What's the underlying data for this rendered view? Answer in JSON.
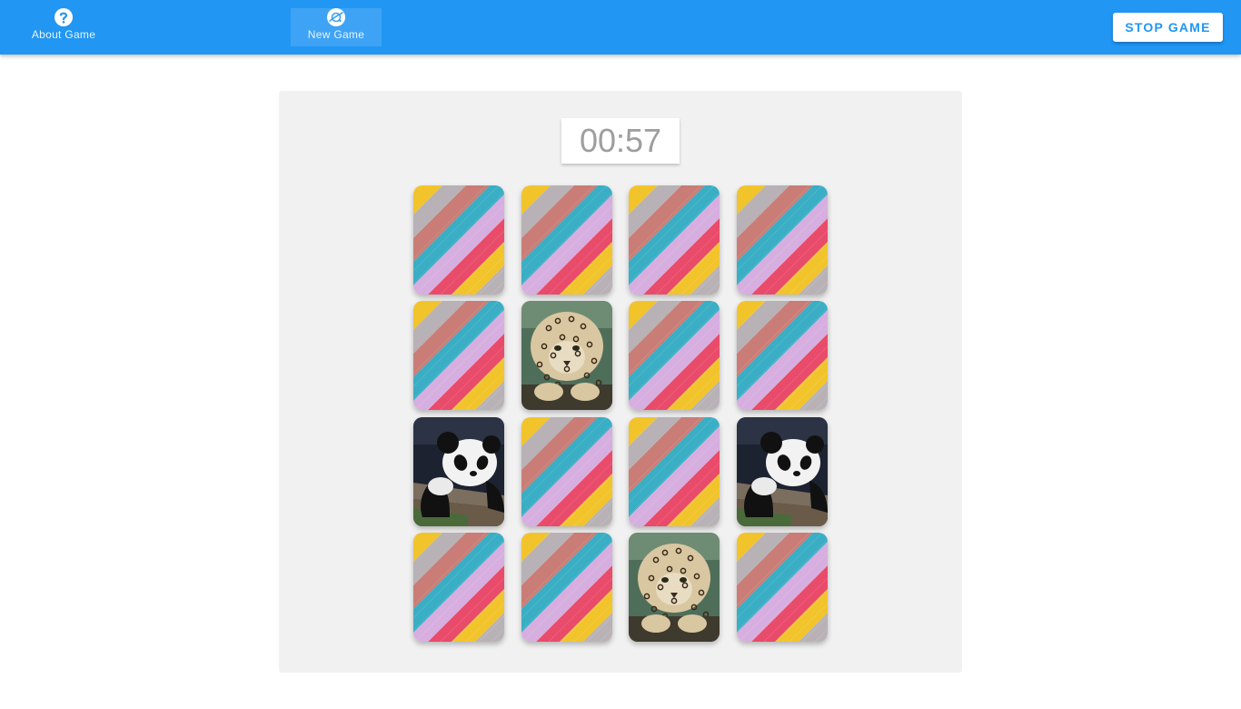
{
  "nav": {
    "about": {
      "label": "About Game",
      "icon": "question-circle-icon"
    },
    "new_game": {
      "label": "New Game",
      "icon": "planet-icon"
    },
    "stop_label": "STOP GAME"
  },
  "timer": {
    "value": "00:57"
  },
  "colors": {
    "topbar": "#2196f3",
    "board": "#f1f1f1",
    "timer_text": "#9e9e9e",
    "stripes": [
      "#e94b6a",
      "#f2c42c",
      "#b8b2b6",
      "#c97d76",
      "#3aaec4",
      "#d7aee0"
    ]
  },
  "cards": [
    {
      "state": "face-down"
    },
    {
      "state": "face-down"
    },
    {
      "state": "face-down"
    },
    {
      "state": "face-down"
    },
    {
      "state": "face-down"
    },
    {
      "state": "revealed",
      "image": "leopard"
    },
    {
      "state": "face-down"
    },
    {
      "state": "face-down"
    },
    {
      "state": "revealed",
      "image": "panda"
    },
    {
      "state": "face-down"
    },
    {
      "state": "face-down"
    },
    {
      "state": "revealed",
      "image": "panda"
    },
    {
      "state": "face-down"
    },
    {
      "state": "face-down"
    },
    {
      "state": "revealed",
      "image": "leopard"
    },
    {
      "state": "face-down"
    }
  ]
}
